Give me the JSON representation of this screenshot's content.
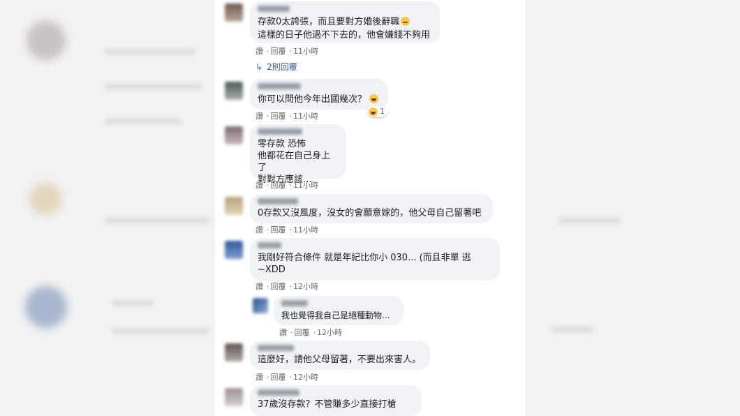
{
  "comments": [
    {
      "text_line1": "存款0太誇張，而且要對方婚後辭職",
      "text_line2": "這樣的日子他過不下去的，他會嫌錢不夠用",
      "emoji": "smile-emoji",
      "like": "讚",
      "reply": "回覆",
      "time": "11小時"
    },
    {
      "text": "你可以問他今年出國幾次？",
      "emoji": "laugh-emoji",
      "reaction_count": "1",
      "like": "讚",
      "reply": "回覆",
      "time": "11小時"
    },
    {
      "text": "零存款 恐怖\n他都花在自己身上了\n對對方應該…",
      "like": "讚",
      "reply": "回覆",
      "time": "11小時"
    },
    {
      "text": "0存款又沒風度，沒女的會願意嫁的，他父母自己留著吧",
      "like": "讚",
      "reply": "回覆",
      "time": "11小時"
    },
    {
      "text": "我剛好符合條件 就是年紀比你小 030... (而且非單 逃\n~XDD",
      "like": "讚",
      "reply": "回覆",
      "time": "12小時"
    },
    {
      "text": "我也覺得我自己是絕種動物...",
      "like": "讚",
      "reply": "回覆",
      "time": "12小時"
    },
    {
      "text": "這麼好，請他父母留著，不要出來害人。",
      "like": "讚",
      "reply": "回覆",
      "time": "12小時"
    },
    {
      "text": "37歲沒存款？不管賺多少直接打槍"
    }
  ],
  "replies_link": "2則回覆",
  "colors": {
    "link": "#385898",
    "bubble": "#f0f2f5",
    "meta": "#65676b"
  }
}
